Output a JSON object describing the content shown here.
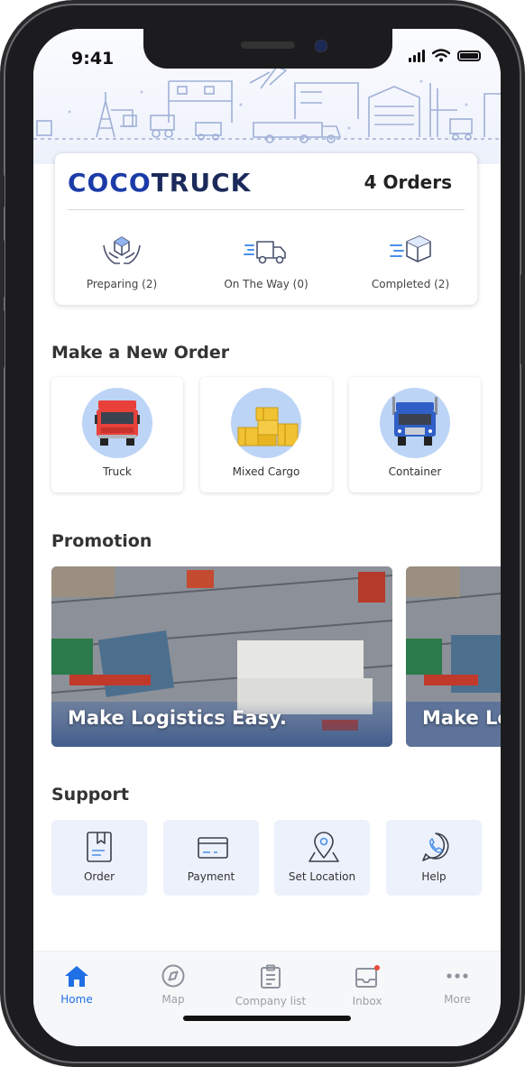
{
  "status": {
    "time": "9:41"
  },
  "summary": {
    "brand_part1": "COCO",
    "brand_part2": "TRUCK",
    "orders": "4 Orders",
    "stats": [
      {
        "label": "Preparing (2)",
        "icon": "hands-box-icon"
      },
      {
        "label": "On The Way (0)",
        "icon": "moving-truck-icon"
      },
      {
        "label": "Completed (2)",
        "icon": "delivered-box-icon"
      }
    ]
  },
  "new_order": {
    "title": "Make a New Order",
    "options": [
      {
        "label": "Truck",
        "icon": "red-truck-icon"
      },
      {
        "label": "Mixed Cargo",
        "icon": "cargo-boxes-icon"
      },
      {
        "label": "Container",
        "icon": "blue-truck-icon"
      }
    ]
  },
  "promotion": {
    "title": "Promotion",
    "slides": [
      {
        "text": "Make Logistics Easy."
      },
      {
        "text": "Make Logistics Easy."
      }
    ]
  },
  "support": {
    "title": "Support",
    "items": [
      {
        "label": "Order",
        "icon": "bookmark-document-icon"
      },
      {
        "label": "Payment",
        "icon": "credit-card-icon"
      },
      {
        "label": "Set Location",
        "icon": "map-pin-icon"
      },
      {
        "label": "Help",
        "icon": "whatsapp-phone-icon"
      }
    ]
  },
  "tabbar": {
    "items": [
      {
        "label": "Home",
        "icon": "home-icon",
        "active": true
      },
      {
        "label": "Map",
        "icon": "compass-icon"
      },
      {
        "label": "Company list",
        "icon": "clipboard-list-icon"
      },
      {
        "label": "Inbox",
        "icon": "inbox-icon"
      },
      {
        "label": "More",
        "icon": "more-dots-icon"
      }
    ]
  },
  "colors": {
    "accent": "#1f6fe5",
    "brand": "#1b3ba8",
    "tile_bg": "#ecf1fc",
    "notification": "#e74c3c"
  }
}
